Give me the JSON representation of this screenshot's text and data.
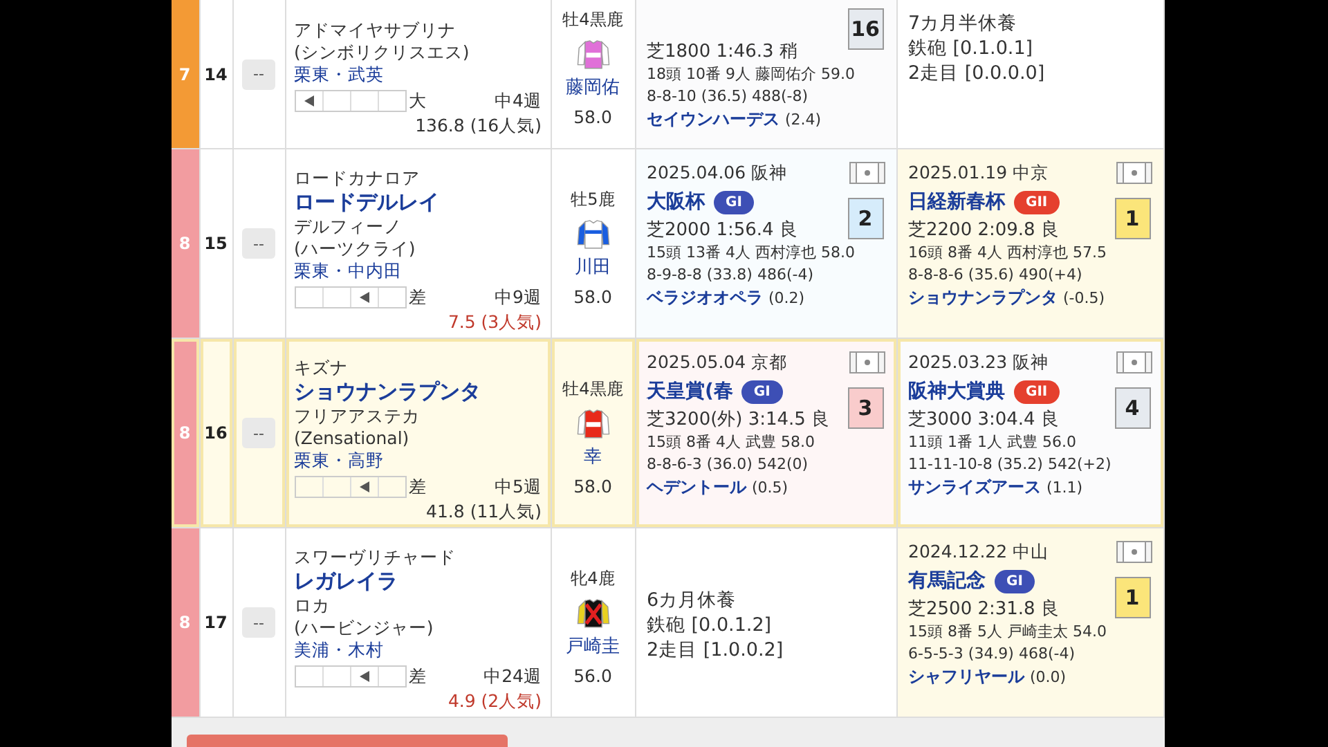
{
  "rows": [
    {
      "waku": "7",
      "color": "#f39a35",
      "number": "14",
      "mark": "--",
      "selected": false,
      "horse": {
        "dam": "アドマイヤサブリナ",
        "damsire": "(シンボリクリスエス)",
        "trainer": "栗東・武英",
        "style_cells": [
          {
            "marked": true
          },
          {
            "marked": false
          },
          {
            "marked": false
          },
          {
            "marked": false
          }
        ],
        "style": "大",
        "interval": "中4週",
        "odds": "136.8 (16人気)",
        "hot": false
      },
      "jockey": {
        "sex_age": "牡4黒鹿",
        "name": "藤岡佑",
        "weight": "58.0",
        "silks": {
          "kind": "body",
          "color": "#e070d8"
        }
      },
      "races": [
        {
          "kind": "race",
          "color": "#e6eaef",
          "course": "芝1800 1:46.3 稍",
          "detail": "18頭 10番 9人 藤岡佑介 59.0",
          "passing": "8-8-10 (36.5) 488(-8)",
          "winner": "セイウンハーデス",
          "margin": "(2.4)",
          "finish": "16"
        },
        {
          "kind": "rest",
          "lines": [
            "7カ月半休養",
            "鉄砲 [0.1.0.1]",
            "2走目 [0.0.0.0]"
          ]
        }
      ]
    },
    {
      "waku": "8",
      "color": "#f29ca0",
      "number": "15",
      "mark": "--",
      "selected": false,
      "horse": {
        "sire": "ロードカナロア",
        "name": "ロードデルレイ",
        "dam": "デルフィーノ",
        "damsire": "(ハーツクライ)",
        "trainer": "栗東・中内田",
        "style_cells": [
          {
            "marked": false
          },
          {
            "marked": false
          },
          {
            "marked": true
          },
          {
            "marked": false
          }
        ],
        "style": "差",
        "interval": "中9週",
        "odds": "7.5 (3人気)",
        "hot": true
      },
      "jockey": {
        "sex_age": "牡5鹿",
        "name": "川田",
        "weight": "58.0",
        "silks": {
          "kind": "band",
          "color": "#1a5ee0"
        }
      },
      "races": [
        {
          "kind": "race",
          "video": true,
          "color": "#d6ecfb",
          "date": "2025.04.06 阪神",
          "name": "大阪杯",
          "grade": {
            "label": "GI",
            "kind": "g1"
          },
          "course": "芝2000 1:56.4 良",
          "detail": "15頭 13番 4人 西村淳也 58.0",
          "passing": "8-9-8-8 (33.8) 486(-4)",
          "winner": "ベラジオオペラ",
          "margin": "(0.2)",
          "finish": "2"
        },
        {
          "kind": "race",
          "video": true,
          "color": "#fbe57a",
          "date": "2025.01.19 中京",
          "name": "日経新春杯",
          "grade": {
            "label": "GII",
            "kind": "g2"
          },
          "course": "芝2200 2:09.8 良",
          "detail": "16頭 8番 4人 西村淳也 57.5",
          "passing": "8-8-8-6 (35.6) 490(+4)",
          "winner": "ショウナンラプンタ",
          "margin": "(-0.5)",
          "finish": "1"
        }
      ]
    },
    {
      "waku": "8",
      "color": "#f29ca0",
      "number": "16",
      "mark": "--",
      "selected": true,
      "horse": {
        "sire": "キズナ",
        "name": "ショウナンラプンタ",
        "dam": "フリアアステカ",
        "damsire": "(Zensational)",
        "trainer": "栗東・高野",
        "style_cells": [
          {
            "marked": false
          },
          {
            "marked": false
          },
          {
            "marked": true
          },
          {
            "marked": false
          }
        ],
        "style": "差",
        "interval": "中5週",
        "odds": "41.8 (11人気)",
        "hot": false
      },
      "jockey": {
        "sex_age": "牡4黒鹿",
        "name": "幸",
        "weight": "58.0",
        "silks": {
          "kind": "body",
          "color": "#e82a1a"
        }
      },
      "races": [
        {
          "kind": "race",
          "video": true,
          "color": "#f9cccc",
          "date": "2025.05.04 京都",
          "name": "天皇賞(春",
          "grade": {
            "label": "GI",
            "kind": "g1"
          },
          "course": "芝3200(外) 3:14.5 良",
          "detail": "15頭 8番 4人 武豊 58.0",
          "passing": "8-8-6-3 (36.0) 542(0)",
          "winner": "ヘデントール",
          "margin": "(0.5)",
          "finish": "3"
        },
        {
          "kind": "race",
          "video": true,
          "color": "#e6eaef",
          "date": "2025.03.23 阪神",
          "name": "阪神大賞典",
          "grade": {
            "label": "GII",
            "kind": "g2"
          },
          "course": "芝3000 3:04.4 良",
          "detail": "11頭 1番 1人 武豊 56.0",
          "passing": "11-11-10-8 (35.2) 542(+2)",
          "winner": "サンライズアース",
          "margin": "(1.1)",
          "finish": "4"
        }
      ]
    },
    {
      "waku": "8",
      "color": "#f29ca0",
      "number": "17",
      "mark": "--",
      "selected": false,
      "horse": {
        "sire": "スワーヴリチャード",
        "name": "レガレイラ",
        "dam": "ロカ",
        "damsire": "(ハービンジャー)",
        "trainer": "美浦・木村",
        "style_cells": [
          {
            "marked": false
          },
          {
            "marked": false
          },
          {
            "marked": true
          },
          {
            "marked": false
          }
        ],
        "style": "差",
        "interval": "中24週",
        "odds": "4.9 (2人気)",
        "hot": true
      },
      "jockey": {
        "sex_age": "牝4鹿",
        "name": "戸崎圭",
        "weight": "56.0",
        "silks": {
          "kind": "cross",
          "color": "#e8d020"
        }
      },
      "races": [
        {
          "kind": "rest",
          "lines": [
            "6カ月休養",
            "鉄砲 [0.0.1.2]",
            "2走目 [1.0.0.2]"
          ]
        },
        {
          "kind": "race",
          "video": true,
          "color": "#fbe57a",
          "date": "2024.12.22 中山",
          "name": "有馬記念",
          "grade": {
            "label": "GI",
            "kind": "g1"
          },
          "course": "芝2500 2:31.8 良",
          "detail": "15頭 8番 5人 戸崎圭太 54.0",
          "passing": "6-5-5-3 (34.9) 468(-4)",
          "winner": "シャフリヤール",
          "margin": "(0.0)",
          "finish": "1"
        }
      ]
    }
  ]
}
